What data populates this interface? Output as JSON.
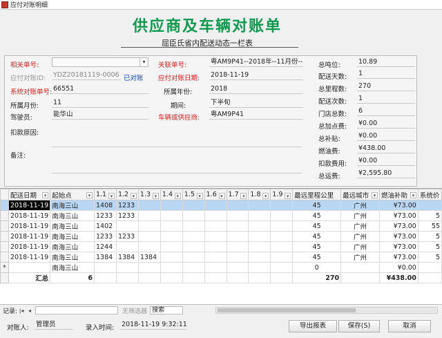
{
  "window": {
    "title": "应付对账明细"
  },
  "header": {
    "title": "供应商及车辆对账单",
    "subtitle": "屈臣氏省内配送动态一栏表"
  },
  "form": {
    "related_no_label": "相关单号:",
    "payable_id_label": "应付对账ID:",
    "payable_id_value": "YDZ20181119-0006",
    "status_value": "已对账",
    "sys_no_label": "系统对账单号:",
    "sys_no_value": "66551",
    "month_label": "所属月份:",
    "month_value": "11",
    "driver_label": "驾驶员:",
    "driver_value": "能华山",
    "deduct_reason_label": "扣款原因:",
    "remark_label": "备注:",
    "assoc_no_label": "关联单号:",
    "assoc_no_value": "粤AM9P41--2018年--11月份--",
    "check_date_label": "应付对账日期:",
    "check_date_value": "2018-11-19",
    "year_label": "所属年份:",
    "year_value": "2018",
    "period_label": "期间:",
    "period_value": "下半旬",
    "vehicle_label": "车辆或供应商:",
    "vehicle_value": "粤AM9P41",
    "total_ton_label": "总吨位:",
    "total_ton_value": "10.89",
    "delivery_days_label": "配送天数:",
    "delivery_days_value": "1",
    "total_mileage_label": "总里程数:",
    "total_mileage_value": "270",
    "delivery_times_label": "配送次数:",
    "delivery_times_value": "1",
    "store_count_label": "门店总数:",
    "store_count_value": "6",
    "total_add_label": "总加点费:",
    "total_add_value": "¥0.00",
    "total_subsidy_label": "总补贴:",
    "total_subsidy_value": "¥0.00",
    "fuel_label": "燃油费:",
    "fuel_value": "¥438.00",
    "deduct_label": "扣款费用:",
    "deduct_value": "¥0.00",
    "total_fee_label": "总运费:",
    "total_fee_value": "¥2,595.80"
  },
  "grid": {
    "columns": [
      "配送日期",
      "起始点",
      "1.1",
      "1.2",
      "1.3",
      "1.4",
      "1.5",
      "1.6",
      "1.7",
      "1.8",
      "1.9",
      "最远里程公里",
      "最远城市",
      "燃油补助",
      "系统价"
    ],
    "rows": [
      [
        "2018-11-19",
        "南海三山",
        "1408",
        "1233",
        "",
        "",
        "",
        "",
        "",
        "",
        "",
        "45",
        "广州",
        "¥73.00",
        ""
      ],
      [
        "2018-11-19",
        "南海三山",
        "1233",
        "1233",
        "",
        "",
        "",
        "",
        "",
        "",
        "",
        "45",
        "广州",
        "¥73.00",
        "5"
      ],
      [
        "2018-11-19",
        "南海三山",
        "1402",
        "",
        "",
        "",
        "",
        "",
        "",
        "",
        "",
        "45",
        "广州",
        "¥73.00",
        "55"
      ],
      [
        "2018-11-19",
        "南海三山",
        "1233",
        "1233",
        "",
        "",
        "",
        "",
        "",
        "",
        "",
        "45",
        "广州",
        "¥73.00",
        "5"
      ],
      [
        "2018-11-19",
        "南海三山",
        "1244",
        "",
        "",
        "",
        "",
        "",
        "",
        "",
        "",
        "45",
        "广州",
        "¥73.00",
        "5"
      ],
      [
        "2018-11-19",
        "南海三山",
        "1384",
        "1384",
        "1384",
        "",
        "",
        "",
        "",
        "",
        "",
        "45",
        "广州",
        "¥73.00",
        "5"
      ]
    ],
    "new_row": {
      "marker": "*",
      "start": "南海三山",
      "km": "0",
      "fuel": "¥0.00"
    },
    "total_row": {
      "label": "汇总",
      "c11": "6",
      "km": "270",
      "fuel": "¥438.00"
    }
  },
  "navbar": {
    "record_label": "记录:",
    "first": "|◂",
    "prev": "◂",
    "filter_label": "无筛选器",
    "search_label": "搜索"
  },
  "footer": {
    "reconciler_label": "对账人:",
    "reconciler_value": "管理员",
    "entry_time_label": "录入时间:",
    "entry_time_value": "2018-11-19 9:32:11",
    "export_btn": "导出报表",
    "save_btn": "保存(S)",
    "cancel_btn": "取消"
  }
}
